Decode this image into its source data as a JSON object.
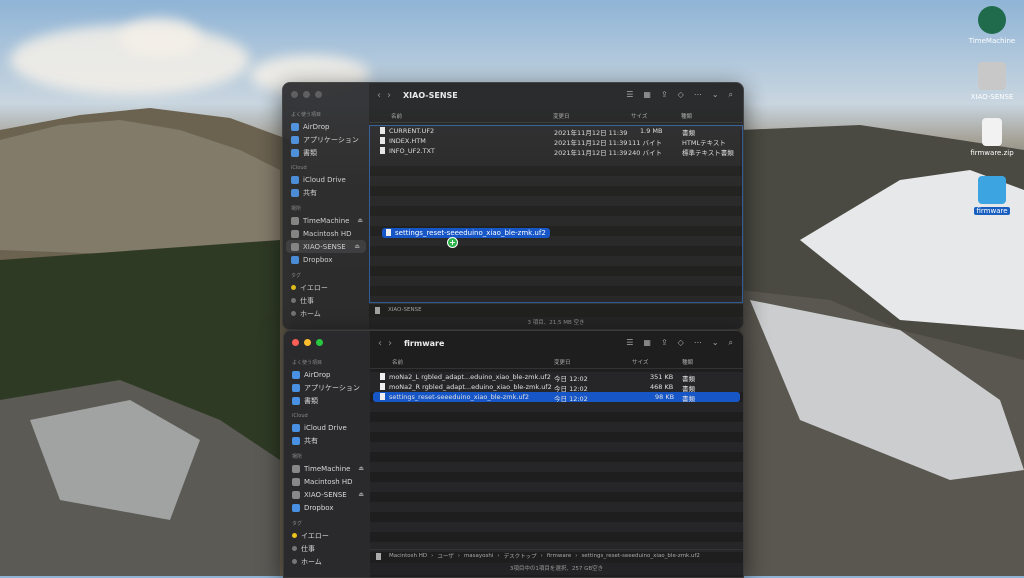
{
  "desktop": {
    "icons": [
      {
        "label": "TimeMachine",
        "icon": "timemachine-icon"
      },
      {
        "label": "XIAO-SENSE",
        "icon": "drive-icon"
      },
      {
        "label": "firmware.zip",
        "icon": "zip-file-icon"
      },
      {
        "label": "firmware",
        "icon": "folder-icon"
      }
    ]
  },
  "back_window": {
    "title": "XIAO-SENSE",
    "sidebar": {
      "favorites_header": "よく使う項目",
      "favorites": [
        "AirDrop",
        "アプリケーション",
        "書類"
      ],
      "icloud_header": "iCloud",
      "icloud": [
        "iCloud Drive",
        "共有"
      ],
      "locations_header": "場所",
      "locations": [
        "TimeMachine",
        "Macintosh HD",
        "XIAO-SENSE",
        "Dropbox"
      ],
      "tags_header": "タグ",
      "tags": [
        "イエロー",
        "仕事",
        "ホーム"
      ]
    },
    "columns": {
      "name": "名前",
      "date": "変更日",
      "size": "サイズ",
      "kind": "種類"
    },
    "files": [
      {
        "name": "CURRENT.UF2",
        "date": "2021年11月12日 11:39",
        "size": "1.9 MB",
        "kind": "書類"
      },
      {
        "name": "INDEX.HTM",
        "date": "2021年11月12日 11:39",
        "size": "111 バイト",
        "kind": "HTMLテキスト"
      },
      {
        "name": "INFO_UF2.TXT",
        "date": "2021年11月12日 11:39",
        "size": "240 バイト",
        "kind": "標準テキスト書類"
      }
    ],
    "drag_item": "settings_reset-seeeduino_xiao_ble-zmk.uf2",
    "pathbar": "XIAO-SENSE",
    "status": "3 項目、21.5 MB 空き"
  },
  "front_window": {
    "title": "firmware",
    "sidebar": {
      "favorites_header": "よく使う項目",
      "favorites": [
        "AirDrop",
        "アプリケーション",
        "書類"
      ],
      "icloud_header": "iCloud",
      "icloud": [
        "iCloud Drive",
        "共有"
      ],
      "locations_header": "場所",
      "locations": [
        "TimeMachine",
        "Macintosh HD",
        "XIAO-SENSE",
        "Dropbox"
      ],
      "tags_header": "タグ",
      "tags": [
        "イエロー",
        "仕事",
        "ホーム"
      ]
    },
    "columns": {
      "name": "名前",
      "date": "変更日",
      "size": "サイズ",
      "kind": "種類"
    },
    "files": [
      {
        "name": "moNa2_L rgbled_adapt...eduino_xiao_ble-zmk.uf2",
        "date": "今日 12:02",
        "size": "351 KB",
        "kind": "書類"
      },
      {
        "name": "moNa2_R rgbled_adapt...eduino_xiao_ble-zmk.uf2",
        "date": "今日 12:02",
        "size": "468 KB",
        "kind": "書類"
      },
      {
        "name": "settings_reset-seeeduino_xiao_ble-zmk.uf2",
        "date": "今日 12:02",
        "size": "98 KB",
        "kind": "書類"
      }
    ],
    "pathbar": [
      "Macintosh HD",
      "ユーザ",
      "masayoshi",
      "デスクトップ",
      "firmware",
      "settings_reset-seeeduino_xiao_ble-zmk.uf2"
    ],
    "status": "3項目中の1項目を選択、257 GB空き"
  }
}
